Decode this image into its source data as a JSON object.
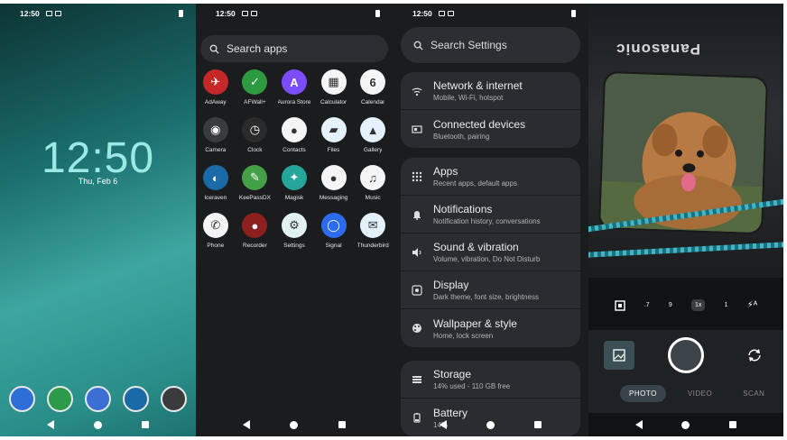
{
  "statusbar": {
    "time": "12:50"
  },
  "home": {
    "clock": "12:50",
    "date": "Thu, Feb 6",
    "dock": [
      {
        "icon": "phone-icon",
        "color": "#2d6fd6"
      },
      {
        "icon": "messaging-icon",
        "color": "#2b9a4a"
      },
      {
        "icon": "contacts-icon",
        "color": "#3b6fd4"
      },
      {
        "icon": "iceraven-icon",
        "color": "#1a6aa8"
      },
      {
        "icon": "camera-icon",
        "color": "#3a3b3d"
      }
    ]
  },
  "drawer": {
    "search_placeholder": "Search apps",
    "apps": [
      {
        "name": "AdAway",
        "icon": "adaway-icon",
        "color": "#c62828",
        "glyph": "✈"
      },
      {
        "name": "AFWall+",
        "icon": "afwall-icon",
        "color": "#2e9a3f",
        "glyph": "✓"
      },
      {
        "name": "Aurora Store",
        "icon": "aurora-store-icon",
        "color": "#7c4dff",
        "glyph": "A"
      },
      {
        "name": "Calculator",
        "icon": "calculator-icon",
        "color": "#f5f5f5",
        "glyph": "▦"
      },
      {
        "name": "Calendar",
        "icon": "calendar-icon",
        "color": "#f5f5f5",
        "glyph": "6"
      },
      {
        "name": "Camera",
        "icon": "camera-icon",
        "color": "#3a3b3d",
        "glyph": "◉"
      },
      {
        "name": "Clock",
        "icon": "clock-icon",
        "color": "#2b2b2b",
        "glyph": "◷"
      },
      {
        "name": "Contacts",
        "icon": "contacts-icon",
        "color": "#f5f5f5",
        "glyph": "●"
      },
      {
        "name": "Files",
        "icon": "files-icon",
        "color": "#e3f2fd",
        "glyph": "▰"
      },
      {
        "name": "Gallery",
        "icon": "gallery-icon",
        "color": "#e3f2fd",
        "glyph": "▲"
      },
      {
        "name": "Iceraven",
        "icon": "iceraven-icon",
        "color": "#1a6aa8",
        "glyph": "◐"
      },
      {
        "name": "KeePassDX",
        "icon": "keepassdx-icon",
        "color": "#43a047",
        "glyph": "✎"
      },
      {
        "name": "Magisk",
        "icon": "magisk-icon",
        "color": "#26a69a",
        "glyph": "✦"
      },
      {
        "name": "Messaging",
        "icon": "messaging-icon",
        "color": "#f5f5f5",
        "glyph": "●"
      },
      {
        "name": "Music",
        "icon": "music-icon",
        "color": "#f5f5f5",
        "glyph": "♫"
      },
      {
        "name": "Phone",
        "icon": "phone-icon",
        "color": "#f5f5f5",
        "glyph": "✆"
      },
      {
        "name": "Recorder",
        "icon": "recorder-icon",
        "color": "#8e1f1f",
        "glyph": "●"
      },
      {
        "name": "Settings",
        "icon": "settings-icon",
        "color": "#e0f2f1",
        "glyph": "⚙"
      },
      {
        "name": "Signal",
        "icon": "signal-icon",
        "color": "#2c6bed",
        "glyph": "◯"
      },
      {
        "name": "Thunderbird",
        "icon": "thunderbird-icon",
        "color": "#e3f2fd",
        "glyph": "✉"
      }
    ]
  },
  "settings": {
    "search_placeholder": "Search Settings",
    "groups": [
      [
        {
          "title": "Network & internet",
          "sub": "Mobile, Wi-Fi, hotspot",
          "icon": "wifi-icon"
        },
        {
          "title": "Connected devices",
          "sub": "Bluetooth, pairing",
          "icon": "devices-icon"
        }
      ],
      [
        {
          "title": "Apps",
          "sub": "Recent apps, default apps",
          "icon": "apps-grid-icon"
        },
        {
          "title": "Notifications",
          "sub": "Notification history, conversations",
          "icon": "bell-icon"
        },
        {
          "title": "Sound & vibration",
          "sub": "Volume, vibration, Do Not Disturb",
          "icon": "speaker-icon"
        },
        {
          "title": "Display",
          "sub": "Dark theme, font size, brightness",
          "icon": "display-icon"
        },
        {
          "title": "Wallpaper & style",
          "sub": "Home, lock screen",
          "icon": "palette-icon"
        }
      ],
      [
        {
          "title": "Storage",
          "sub": "14% used - 110 GB free",
          "icon": "storage-icon"
        },
        {
          "title": "Battery",
          "sub": "14%",
          "icon": "battery-icon"
        }
      ]
    ]
  },
  "camera": {
    "brand_text": "Panasonic",
    "zoom_levels": [
      ".7",
      "9",
      "1x",
      "1"
    ],
    "active_zoom": "1x",
    "modes": [
      "PHOTO",
      "VIDEO",
      "SCAN"
    ],
    "active_mode": "PHOTO"
  }
}
